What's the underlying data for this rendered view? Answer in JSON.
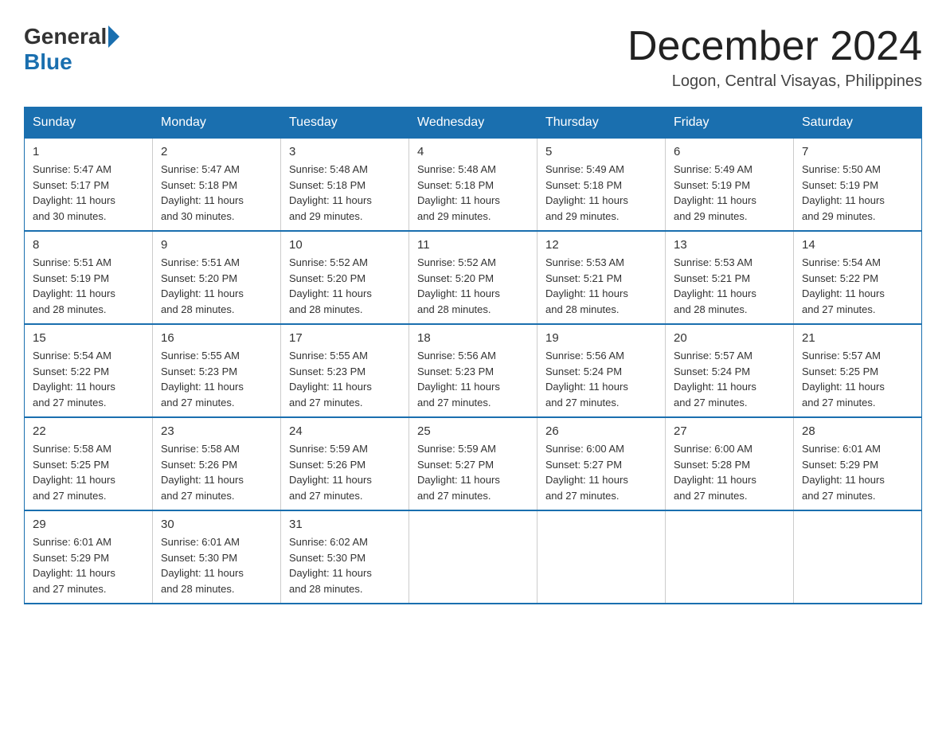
{
  "header": {
    "logo_general": "General",
    "logo_blue": "Blue",
    "month_title": "December 2024",
    "location": "Logon, Central Visayas, Philippines"
  },
  "days_of_week": [
    "Sunday",
    "Monday",
    "Tuesday",
    "Wednesday",
    "Thursday",
    "Friday",
    "Saturday"
  ],
  "weeks": [
    [
      {
        "num": "1",
        "sunrise": "5:47 AM",
        "sunset": "5:17 PM",
        "daylight": "11 hours and 30 minutes."
      },
      {
        "num": "2",
        "sunrise": "5:47 AM",
        "sunset": "5:18 PM",
        "daylight": "11 hours and 30 minutes."
      },
      {
        "num": "3",
        "sunrise": "5:48 AM",
        "sunset": "5:18 PM",
        "daylight": "11 hours and 29 minutes."
      },
      {
        "num": "4",
        "sunrise": "5:48 AM",
        "sunset": "5:18 PM",
        "daylight": "11 hours and 29 minutes."
      },
      {
        "num": "5",
        "sunrise": "5:49 AM",
        "sunset": "5:18 PM",
        "daylight": "11 hours and 29 minutes."
      },
      {
        "num": "6",
        "sunrise": "5:49 AM",
        "sunset": "5:19 PM",
        "daylight": "11 hours and 29 minutes."
      },
      {
        "num": "7",
        "sunrise": "5:50 AM",
        "sunset": "5:19 PM",
        "daylight": "11 hours and 29 minutes."
      }
    ],
    [
      {
        "num": "8",
        "sunrise": "5:51 AM",
        "sunset": "5:19 PM",
        "daylight": "11 hours and 28 minutes."
      },
      {
        "num": "9",
        "sunrise": "5:51 AM",
        "sunset": "5:20 PM",
        "daylight": "11 hours and 28 minutes."
      },
      {
        "num": "10",
        "sunrise": "5:52 AM",
        "sunset": "5:20 PM",
        "daylight": "11 hours and 28 minutes."
      },
      {
        "num": "11",
        "sunrise": "5:52 AM",
        "sunset": "5:20 PM",
        "daylight": "11 hours and 28 minutes."
      },
      {
        "num": "12",
        "sunrise": "5:53 AM",
        "sunset": "5:21 PM",
        "daylight": "11 hours and 28 minutes."
      },
      {
        "num": "13",
        "sunrise": "5:53 AM",
        "sunset": "5:21 PM",
        "daylight": "11 hours and 28 minutes."
      },
      {
        "num": "14",
        "sunrise": "5:54 AM",
        "sunset": "5:22 PM",
        "daylight": "11 hours and 27 minutes."
      }
    ],
    [
      {
        "num": "15",
        "sunrise": "5:54 AM",
        "sunset": "5:22 PM",
        "daylight": "11 hours and 27 minutes."
      },
      {
        "num": "16",
        "sunrise": "5:55 AM",
        "sunset": "5:23 PM",
        "daylight": "11 hours and 27 minutes."
      },
      {
        "num": "17",
        "sunrise": "5:55 AM",
        "sunset": "5:23 PM",
        "daylight": "11 hours and 27 minutes."
      },
      {
        "num": "18",
        "sunrise": "5:56 AM",
        "sunset": "5:23 PM",
        "daylight": "11 hours and 27 minutes."
      },
      {
        "num": "19",
        "sunrise": "5:56 AM",
        "sunset": "5:24 PM",
        "daylight": "11 hours and 27 minutes."
      },
      {
        "num": "20",
        "sunrise": "5:57 AM",
        "sunset": "5:24 PM",
        "daylight": "11 hours and 27 minutes."
      },
      {
        "num": "21",
        "sunrise": "5:57 AM",
        "sunset": "5:25 PM",
        "daylight": "11 hours and 27 minutes."
      }
    ],
    [
      {
        "num": "22",
        "sunrise": "5:58 AM",
        "sunset": "5:25 PM",
        "daylight": "11 hours and 27 minutes."
      },
      {
        "num": "23",
        "sunrise": "5:58 AM",
        "sunset": "5:26 PM",
        "daylight": "11 hours and 27 minutes."
      },
      {
        "num": "24",
        "sunrise": "5:59 AM",
        "sunset": "5:26 PM",
        "daylight": "11 hours and 27 minutes."
      },
      {
        "num": "25",
        "sunrise": "5:59 AM",
        "sunset": "5:27 PM",
        "daylight": "11 hours and 27 minutes."
      },
      {
        "num": "26",
        "sunrise": "6:00 AM",
        "sunset": "5:27 PM",
        "daylight": "11 hours and 27 minutes."
      },
      {
        "num": "27",
        "sunrise": "6:00 AM",
        "sunset": "5:28 PM",
        "daylight": "11 hours and 27 minutes."
      },
      {
        "num": "28",
        "sunrise": "6:01 AM",
        "sunset": "5:29 PM",
        "daylight": "11 hours and 27 minutes."
      }
    ],
    [
      {
        "num": "29",
        "sunrise": "6:01 AM",
        "sunset": "5:29 PM",
        "daylight": "11 hours and 27 minutes."
      },
      {
        "num": "30",
        "sunrise": "6:01 AM",
        "sunset": "5:30 PM",
        "daylight": "11 hours and 28 minutes."
      },
      {
        "num": "31",
        "sunrise": "6:02 AM",
        "sunset": "5:30 PM",
        "daylight": "11 hours and 28 minutes."
      },
      null,
      null,
      null,
      null
    ]
  ],
  "labels": {
    "sunrise": "Sunrise:",
    "sunset": "Sunset:",
    "daylight": "Daylight:"
  }
}
